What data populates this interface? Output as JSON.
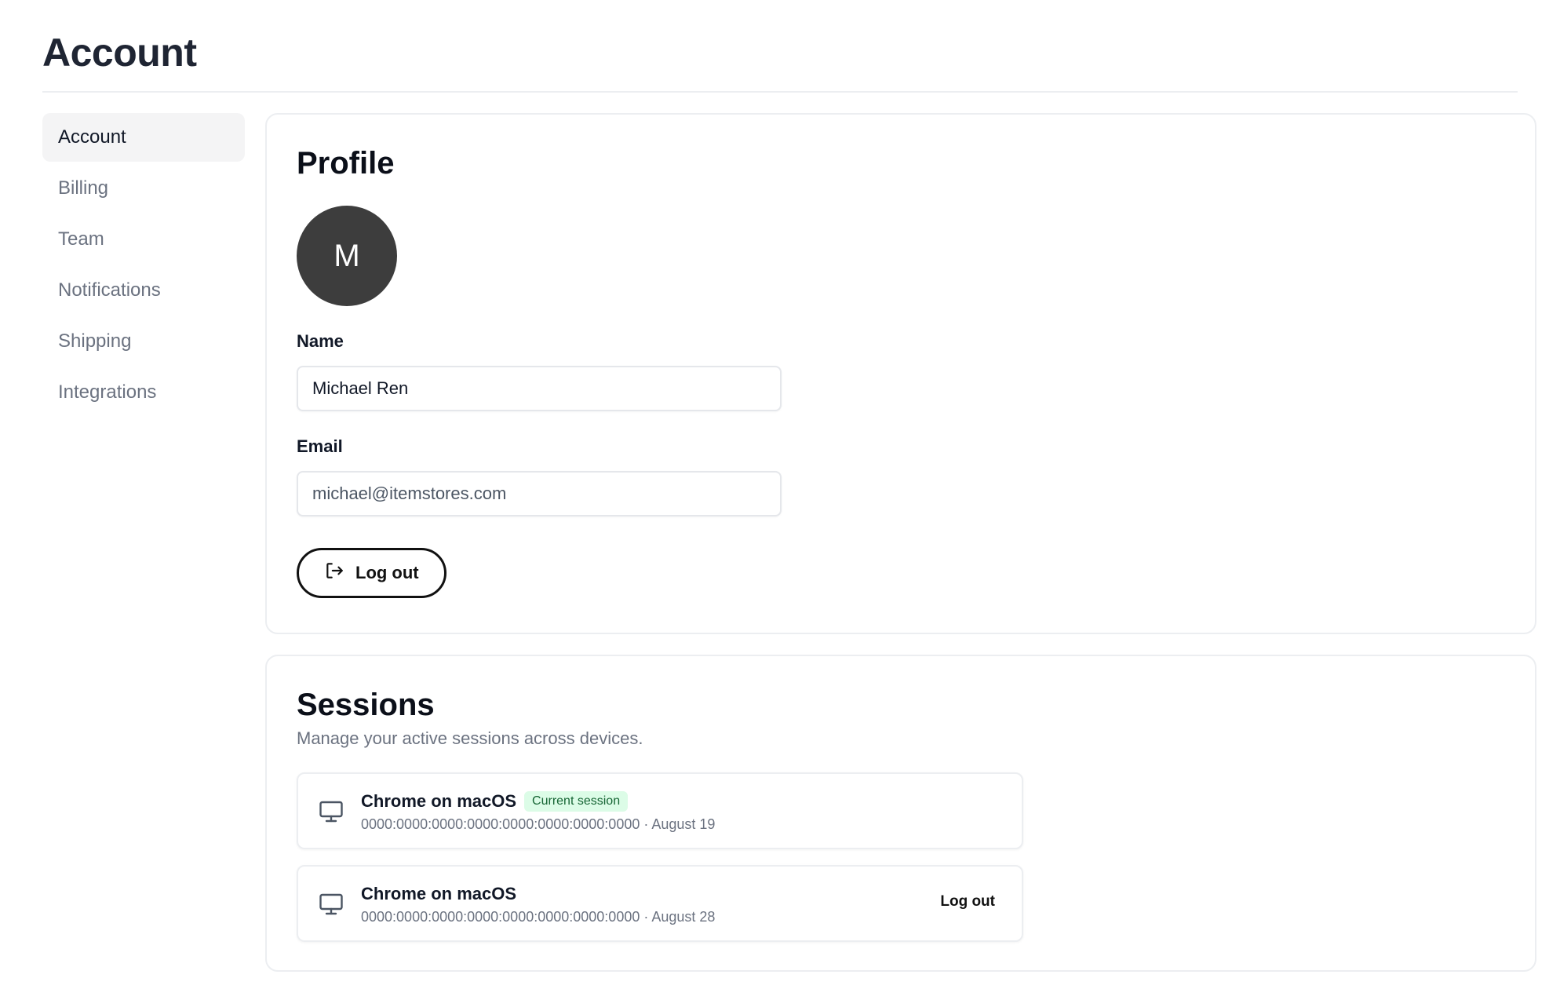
{
  "page": {
    "title": "Account"
  },
  "sidebar": {
    "items": [
      {
        "label": "Account",
        "active": true
      },
      {
        "label": "Billing"
      },
      {
        "label": "Team"
      },
      {
        "label": "Notifications"
      },
      {
        "label": "Shipping"
      },
      {
        "label": "Integrations"
      }
    ]
  },
  "profile": {
    "title": "Profile",
    "avatar_initial": "M",
    "name_label": "Name",
    "name_value": "Michael Ren",
    "email_label": "Email",
    "email_value": "michael@itemstores.com",
    "logout_label": "Log out",
    "logout_icon": "logout-icon"
  },
  "sessions": {
    "title": "Sessions",
    "subtitle": "Manage your active sessions across devices.",
    "items": [
      {
        "device": "Chrome on macOS",
        "badge": "Current session",
        "meta": "0000:0000:0000:0000:0000:0000:0000:0000 · August 19",
        "icon": "monitor-icon"
      },
      {
        "device": "Chrome on macOS",
        "meta": "0000:0000:0000:0000:0000:0000:0000:0000 · August 28",
        "action": "Log out",
        "icon": "monitor-icon"
      }
    ]
  },
  "colors": {
    "accent_dark": "#111111",
    "avatar_bg": "#3d3d3d",
    "badge_bg": "#dcfce7",
    "badge_text": "#166534",
    "muted_text": "#6b7280",
    "border": "#eceef1"
  }
}
